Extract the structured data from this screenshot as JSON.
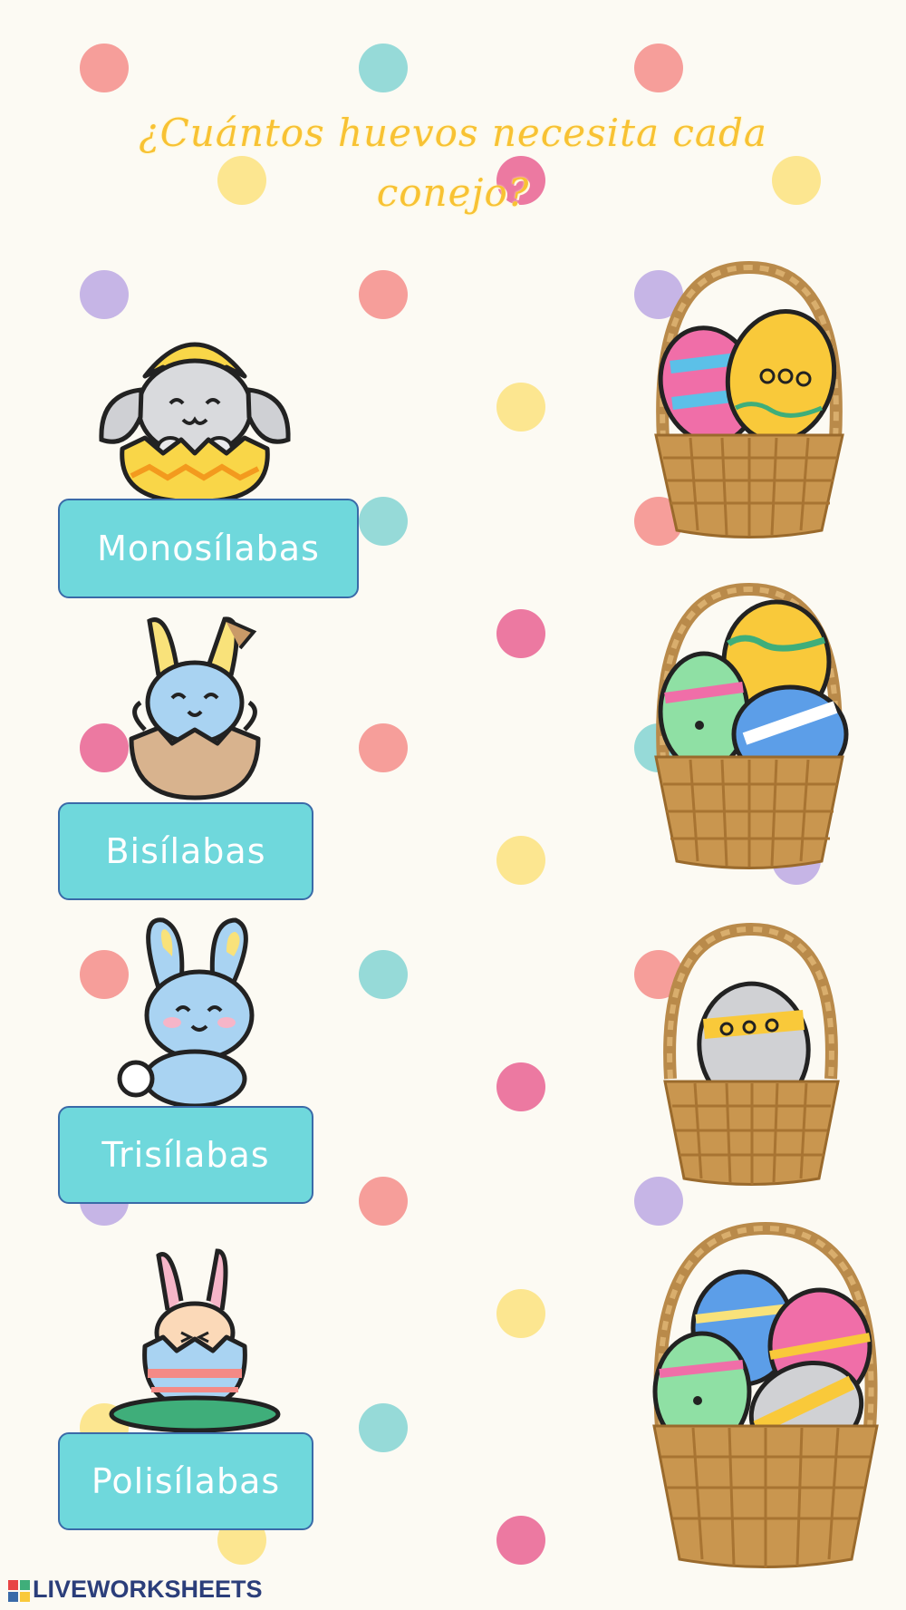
{
  "title": {
    "line1": "¿Cuántos huevos necesita cada",
    "line2": "conejo?"
  },
  "colors": {
    "background": "#fcfaf3",
    "title": "#f8c233",
    "label_fill": "#6fd8dc",
    "label_border": "#3a6aa8",
    "dot_red": "#f48a86",
    "dot_teal": "#7fd3d2",
    "dot_yellow": "#fbe27a",
    "dot_purple": "#b9a6e3",
    "dot_pink": "#e85d8f"
  },
  "labels": [
    {
      "text": "Monosílabas",
      "icon": "bunny-in-egg-icon",
      "basket": "basket-two-eggs-icon"
    },
    {
      "text": "Bisílabas",
      "icon": "bunny-in-shell-icon",
      "basket": "basket-three-eggs-icon"
    },
    {
      "text": "Trisílabas",
      "icon": "sitting-bunny-icon",
      "basket": "basket-one-egg-icon"
    },
    {
      "text": "Polisílabas",
      "icon": "bunny-egg-costume-icon",
      "basket": "basket-four-eggs-icon"
    }
  ],
  "footer": {
    "brand": "LIVEWORKSHEETS"
  }
}
